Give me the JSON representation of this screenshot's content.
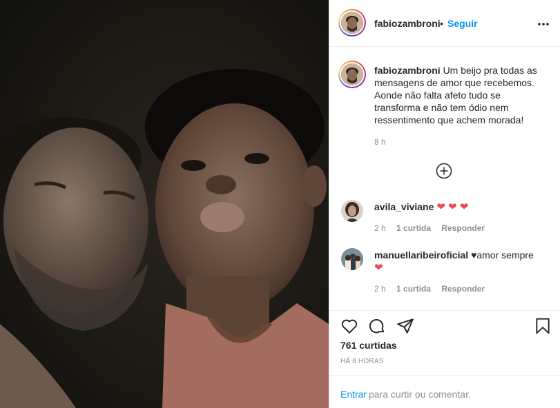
{
  "post": {
    "username": "fabiozambroni",
    "separator": "•",
    "follow_label": "Seguir",
    "more_icon": "more-options-icon"
  },
  "caption": {
    "username": "fabiozambroni",
    "text": "Um beijo pra todas as mensagens de amor que recebemos. Aonde não falta afeto tudo se transforma e não tem ódio nem ressentimento que achem morada!",
    "time": "8 h"
  },
  "load_more_icon": "add-circle-icon",
  "comments": [
    {
      "username": "avila_viviane",
      "text": "",
      "hearts": "❤ ❤ ❤",
      "time": "2 h",
      "likes": "1 curtida",
      "reply": "Responder"
    },
    {
      "username": "manuellaribeiroficial",
      "text": "♥amor sempre",
      "hearts": "❤",
      "time": "2 h",
      "likes": "1 curtida",
      "reply": "Responder"
    }
  ],
  "actions": {
    "like_icon": "heart-icon",
    "comment_icon": "comment-icon",
    "share_icon": "share-icon",
    "save_icon": "bookmark-icon"
  },
  "likes_count": "761 curtidas",
  "timestamp": "HÁ 8 HORAS",
  "comment_box": {
    "login_link": "Entrar",
    "prompt": "para curtir ou comentar."
  },
  "colors": {
    "accent": "#0095f6",
    "heart": "#ed4956",
    "muted": "#8e8e8e",
    "text": "#262626"
  }
}
